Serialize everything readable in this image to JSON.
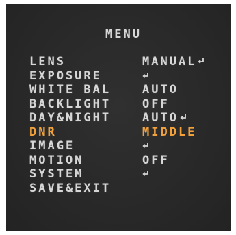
{
  "menu": {
    "title": "MENU",
    "items": [
      {
        "label": "LENS",
        "value": "MANUAL",
        "enter_icon": true
      },
      {
        "label": "EXPOSURE",
        "value": "",
        "enter_icon": true
      },
      {
        "label": "WHITE BAL",
        "value": "AUTO",
        "enter_icon": false
      },
      {
        "label": "BACKLIGHT",
        "value": "OFF",
        "enter_icon": false
      },
      {
        "label": "DAY&NIGHT",
        "value": "AUTO",
        "enter_icon": true
      },
      {
        "label": "DNR",
        "value": "MIDDLE",
        "enter_icon": false,
        "selected": true
      },
      {
        "label": "IMAGE",
        "value": "",
        "enter_icon": true
      },
      {
        "label": "MOTION",
        "value": "OFF",
        "enter_icon": false
      },
      {
        "label": "SYSTEM",
        "value": "",
        "enter_icon": true
      },
      {
        "label": "SAVE&EXIT",
        "value": "",
        "enter_icon": false
      }
    ],
    "icon_name": "enter-return-icon"
  },
  "colors": {
    "background": "#2b2b2b",
    "text": "#d6d6d6",
    "highlight": "#f2a13a"
  }
}
